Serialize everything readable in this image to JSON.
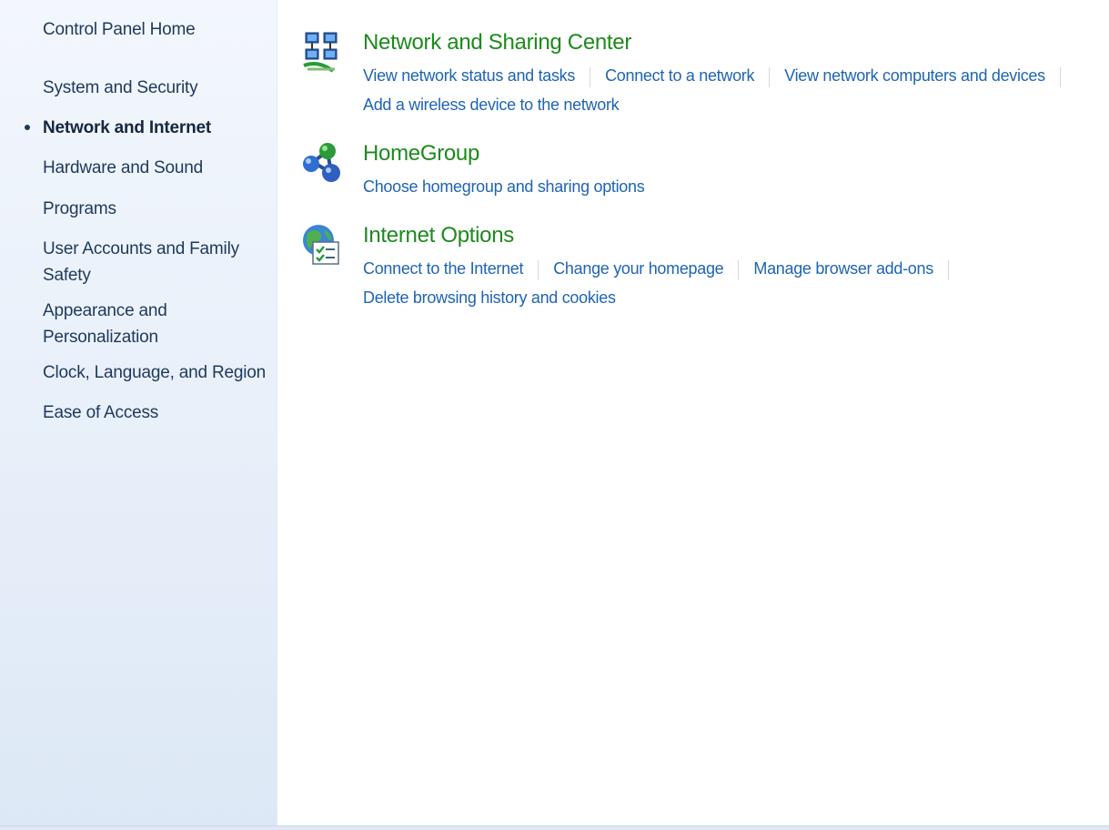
{
  "sidebar": {
    "home": "Control Panel Home",
    "items": [
      {
        "label": "System and Security",
        "active": false
      },
      {
        "label": "Network and Internet",
        "active": true
      },
      {
        "label": "Hardware and Sound",
        "active": false
      },
      {
        "label": "Programs",
        "active": false
      },
      {
        "label": "User Accounts and Family Safety",
        "active": false
      },
      {
        "label": "Appearance and Personalization",
        "active": false
      },
      {
        "label": "Clock, Language, and Region",
        "active": false
      },
      {
        "label": "Ease of Access",
        "active": false
      }
    ]
  },
  "categories": [
    {
      "title": "Network and Sharing Center",
      "icon": "network-sharing-icon",
      "links_row1": [
        "View network status and tasks",
        "Connect to a network",
        "View network computers and devices"
      ],
      "links_row2": [
        "Add a wireless device to the network"
      ]
    },
    {
      "title": "HomeGroup",
      "icon": "homegroup-icon",
      "links_row1": [
        "Choose homegroup and sharing options"
      ],
      "links_row2": []
    },
    {
      "title": "Internet Options",
      "icon": "internet-options-icon",
      "links_row1": [
        "Connect to the Internet",
        "Change your homepage",
        "Manage browser add-ons"
      ],
      "links_row2": [
        "Delete browsing history and cookies"
      ]
    }
  ],
  "colors": {
    "title_green": "#1d8a1d",
    "link_blue": "#1f64b3",
    "nav_text": "#1e395b"
  }
}
